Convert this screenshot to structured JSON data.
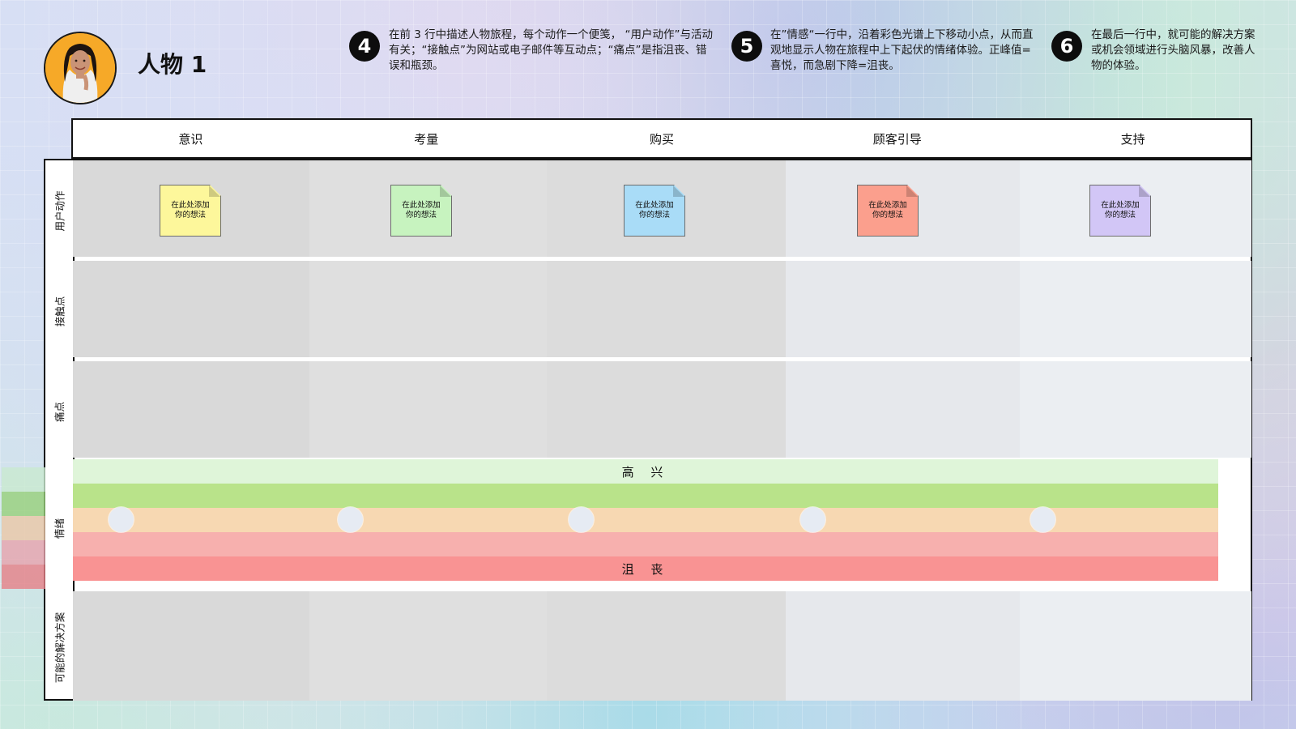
{
  "persona": {
    "title": "人物 1",
    "avatar_icon": "persona-photo"
  },
  "instructions": [
    {
      "number": "4",
      "text": "在前 3 行中描述人物旅程，每个动作一个便笺， “用户动作”与活动有关；“接触点”为网站或电子邮件等互动点；“痛点”是指沮丧、错误和瓶颈。"
    },
    {
      "number": "5",
      "text": "在”情感“一行中，沿着彩色光谱上下移动小点，从而直观地显示人物在旅程中上下起伏的情绪体验。正峰值=喜悦，而急剧下降=沮丧。"
    },
    {
      "number": "6",
      "text": "在最后一行中，就可能的解决方案或机会领域进行头脑风暴，改善人物的体验。"
    }
  ],
  "stages": [
    "意识",
    "考量",
    "购买",
    "顾客引导",
    "支持"
  ],
  "rows": [
    "用户动作",
    "接触点",
    "痛点",
    "情绪",
    "可能的解决方案"
  ],
  "stickies": [
    {
      "text": "在此处添加你的想法",
      "color": "#fdf79b"
    },
    {
      "text": "在此处添加你的想法",
      "color": "#c7f3bf"
    },
    {
      "text": "在此处添加你的想法",
      "color": "#a9dcf7"
    },
    {
      "text": "在此处添加你的想法",
      "color": "#fb9f8d"
    },
    {
      "text": "在此处添加你的想法",
      "color": "#d2c6f6"
    }
  ],
  "emotion": {
    "top_label": "高 兴",
    "bottom_label": "沮 丧",
    "bands": [
      "#dff5d9",
      "#b9e38a",
      "#f7d8b2",
      "#f7b0ae",
      "#f99393"
    ],
    "dot_levels": [
      3,
      3,
      3,
      3,
      3
    ]
  },
  "colors": {
    "stage_columns": [
      "#d9d9d9",
      "#dfdfdf",
      "#dcdcdc",
      "#e6e8ec",
      "#ebeef2"
    ]
  }
}
